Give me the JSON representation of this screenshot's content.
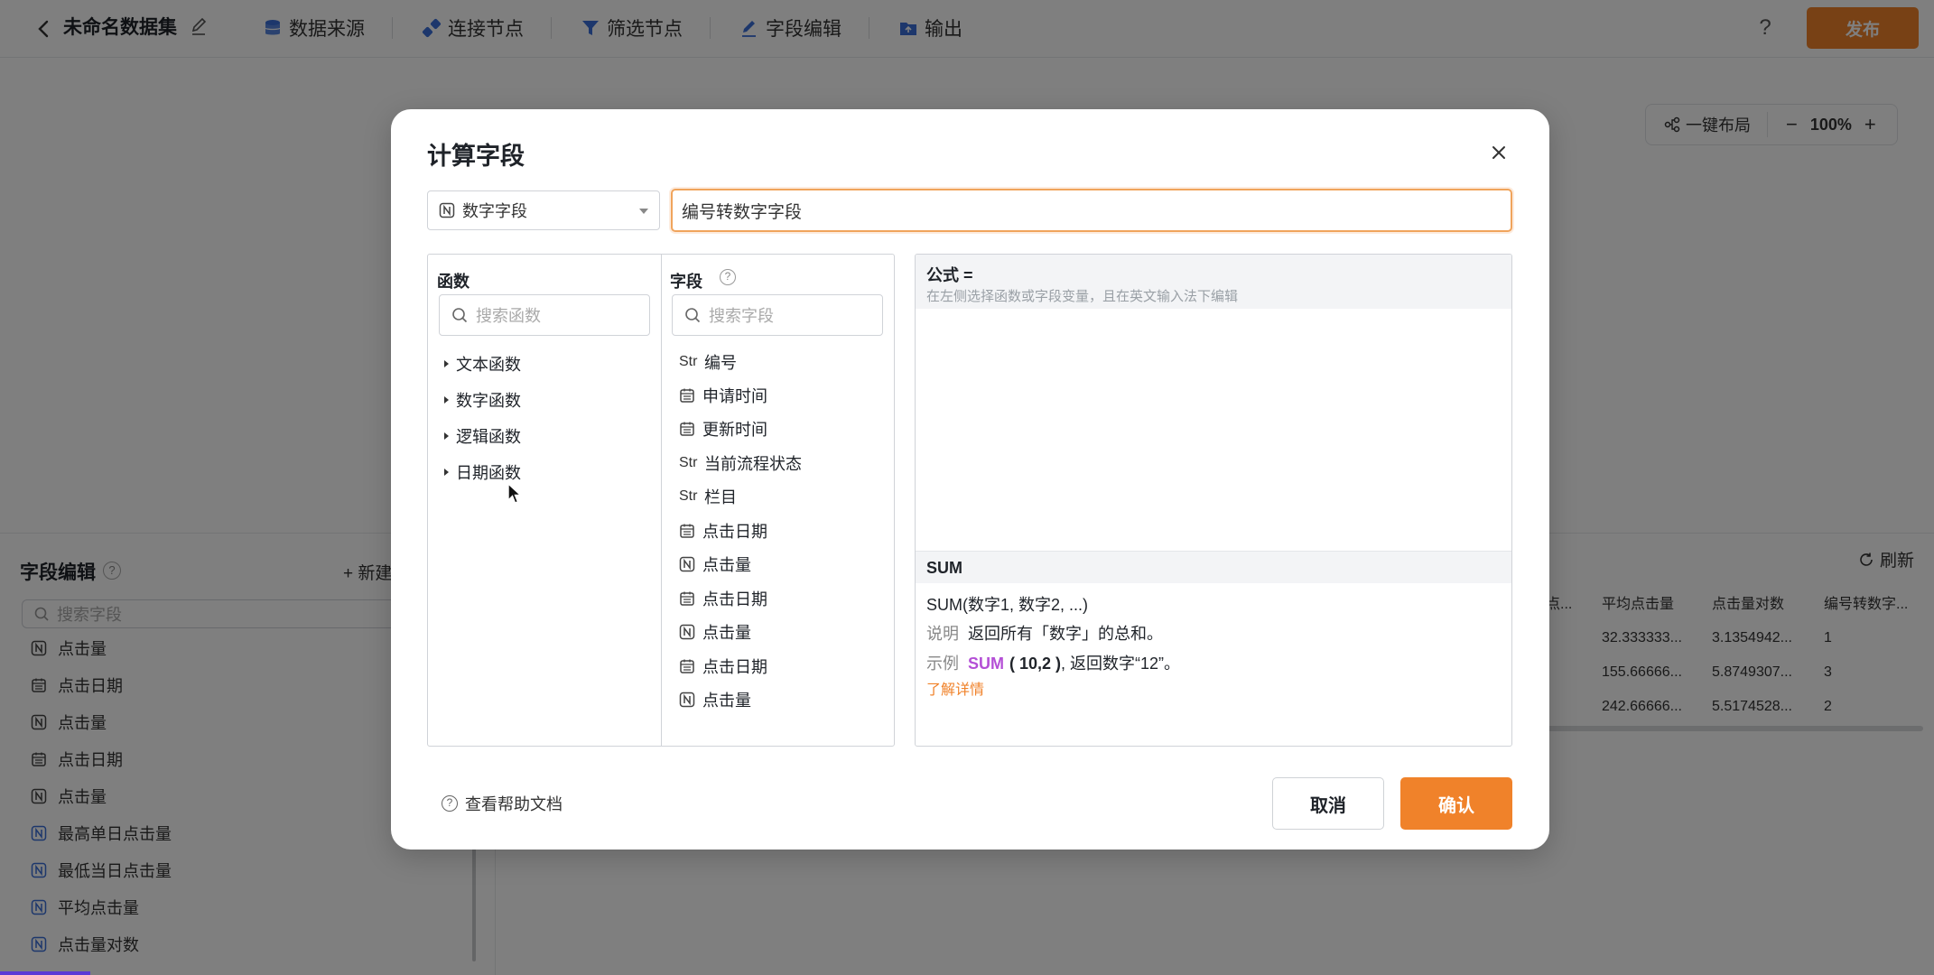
{
  "topbar": {
    "title": "未命名数据集",
    "nav": [
      {
        "label": "数据来源",
        "icon": "database-icon"
      },
      {
        "label": "连接节点",
        "icon": "link-node-icon"
      },
      {
        "label": "筛选节点",
        "icon": "filter-icon"
      },
      {
        "label": "字段编辑",
        "icon": "pencil-icon"
      },
      {
        "label": "输出",
        "icon": "export-icon"
      }
    ],
    "help": "?",
    "publish": "发布"
  },
  "canvas": {
    "layout_label": "一键布局",
    "zoom": "100%"
  },
  "field_edit": {
    "title": "字段编辑",
    "new_label": "+ 新建",
    "search_placeholder": "搜索字段",
    "items": [
      {
        "type": "number",
        "label": "点击量"
      },
      {
        "type": "date",
        "label": "点击日期"
      },
      {
        "type": "number",
        "label": "点击量"
      },
      {
        "type": "date",
        "label": "点击日期"
      },
      {
        "type": "number",
        "label": "点击量"
      },
      {
        "type": "number-calc",
        "label": "最高单日点击量"
      },
      {
        "type": "number-calc",
        "label": "最低当日点击量"
      },
      {
        "type": "number-calc",
        "label": "平均点击量"
      },
      {
        "type": "number-calc",
        "label": "点击量对数"
      }
    ]
  },
  "preview": {
    "refresh_label": "刷新",
    "headers": [
      "点...",
      "平均点击量",
      "点击量对数",
      "编号转数字..."
    ],
    "rows": [
      [
        "32.333333...",
        "3.1354942...",
        "1"
      ],
      [
        "155.66666...",
        "5.8749307...",
        "3"
      ],
      [
        "242.66666...",
        "5.5174528...",
        "2"
      ]
    ]
  },
  "modal": {
    "title": "计算字段",
    "type_select": "数字字段",
    "name_value": "编号转数字字段",
    "functions": {
      "header": "函数",
      "search_placeholder": "搜索函数",
      "groups": [
        "文本函数",
        "数字函数",
        "逻辑函数",
        "日期函数"
      ]
    },
    "fields": {
      "header": "字段",
      "search_placeholder": "搜索字段",
      "items": [
        {
          "type": "str",
          "type_label": "Str",
          "label": "编号"
        },
        {
          "type": "date",
          "label": "申请时间"
        },
        {
          "type": "date",
          "label": "更新时间"
        },
        {
          "type": "str",
          "type_label": "Str",
          "label": "当前流程状态"
        },
        {
          "type": "str",
          "type_label": "Str",
          "label": "栏目"
        },
        {
          "type": "date",
          "label": "点击日期"
        },
        {
          "type": "number",
          "label": "点击量"
        },
        {
          "type": "date",
          "label": "点击日期"
        },
        {
          "type": "number",
          "label": "点击量"
        },
        {
          "type": "date",
          "label": "点击日期"
        },
        {
          "type": "number",
          "label": "点击量"
        }
      ]
    },
    "formula": {
      "label": "公式 =",
      "hint": "在左侧选择函数或字段变量，且在英文输入法下编辑"
    },
    "func_help": {
      "name": "SUM",
      "syntax": "SUM(数字1, 数字2, ...)",
      "desc_label": "说明",
      "desc": "返回所有「数字」的总和。",
      "example_label": "示例",
      "example_kw": "SUM",
      "example_args": "( 10,2 )",
      "example_result": ", 返回数字“12”。",
      "link": "了解详情"
    },
    "help_doc": "查看帮助文档",
    "cancel": "取消",
    "confirm": "确认"
  },
  "colors": {
    "accent": "#f0822a",
    "keyword": "#b44fd6",
    "calc_icon": "#3a6fd8"
  }
}
